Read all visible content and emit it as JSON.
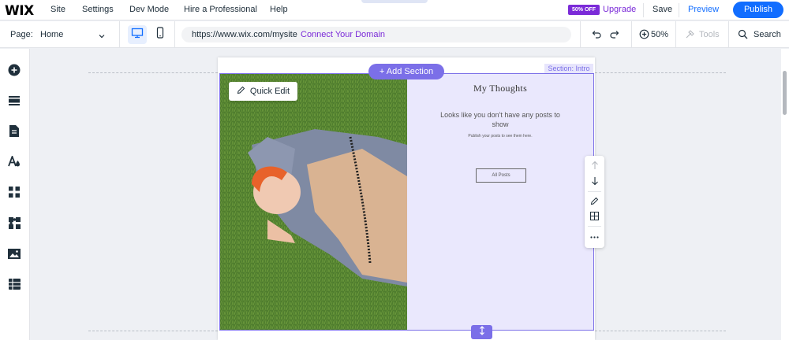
{
  "topbar": {
    "logo": "WIX",
    "menu": [
      "Site",
      "Settings",
      "Dev Mode",
      "Hire a Professional",
      "Help"
    ],
    "badge": "50% OFF",
    "upgrade": "Upgrade",
    "save": "Save",
    "preview": "Preview",
    "publish": "Publish"
  },
  "toolbar": {
    "page_label": "Page:",
    "page_value": "Home",
    "url": "https://www.wix.com/mysite",
    "connect": "Connect Your Domain",
    "zoom": "50%",
    "tools": "Tools",
    "search": "Search"
  },
  "leftbar": {
    "icons": [
      "add-elements-icon",
      "sections-icon",
      "pages-icon",
      "design-icon",
      "apps-icon",
      "business-icon",
      "media-icon",
      "cms-icon"
    ]
  },
  "canvas": {
    "add_section": "+ Add Section",
    "section_label": "Section: Intro",
    "quick_edit": "Quick Edit",
    "blog": {
      "title": "My Thoughts",
      "message": "Looks like you don't have any posts to show",
      "sub": "Publish your posts to see them here.",
      "button": "All Posts"
    }
  },
  "colors": {
    "brand_blue": "#116dff",
    "purple": "#7b2bd8",
    "section_purple": "#7b6fe8",
    "blog_bg": "#eae8fd"
  }
}
